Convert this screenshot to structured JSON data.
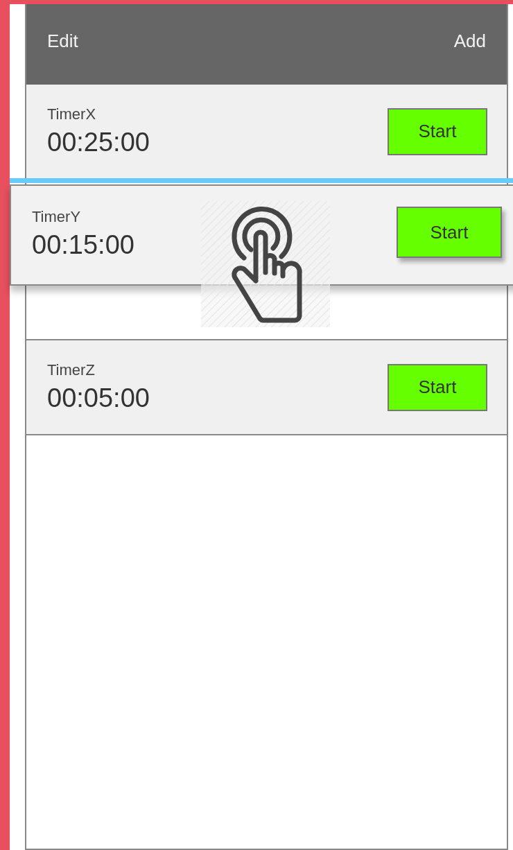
{
  "header": {
    "left_action": "Edit",
    "right_action": "Add"
  },
  "timers": [
    {
      "name": "TimerX",
      "time": "00:25:00",
      "button": "Start",
      "dragging": false
    },
    {
      "name": "TimerY",
      "time": "00:15:00",
      "button": "Start",
      "dragging": true
    },
    {
      "name": "TimerZ",
      "time": "00:05:00",
      "button": "Start",
      "dragging": false
    }
  ]
}
